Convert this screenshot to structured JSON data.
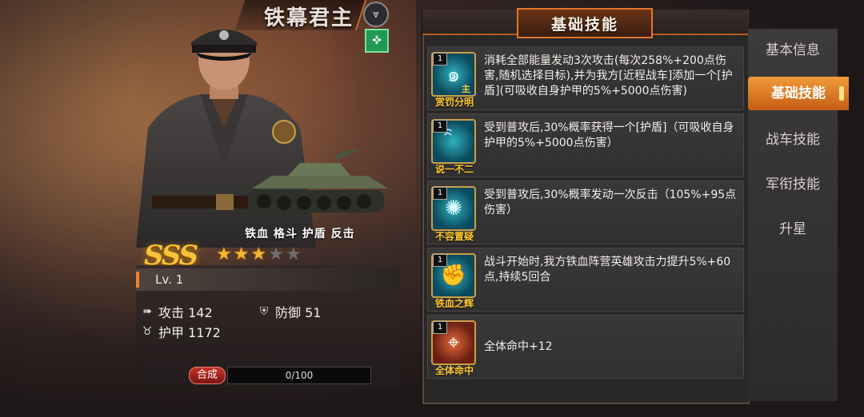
{
  "hero": {
    "name": "铁幕君主",
    "rank_icon": "chevron-rank-icon",
    "class_icon": "cross-class-icon",
    "tank_tags": "铁血 格斗 护盾 反击",
    "grade": "SSS",
    "stars": {
      "filled": 3,
      "total": 5
    },
    "level": "Lv. 1",
    "stats": {
      "attack": "攻击 142",
      "defense": "防御 51",
      "armor": "护甲 1172"
    },
    "compose_label": "合成",
    "progress": {
      "text": "0/100",
      "value": 0,
      "max": 100
    }
  },
  "panel": {
    "title": "基础技能",
    "skills": [
      {
        "level": "1",
        "tag": "主",
        "name": "赏罚分明",
        "icon": "ring-swirl-icon",
        "desc": "消耗全部能量发动3次攻击(每次258%+200点伤害,随机选择目标),并为我方[近程战车]添加一个[护盾](可吸收自身护甲的5%+5000点伤害)"
      },
      {
        "level": "1",
        "tag": "",
        "name": "说一不二",
        "icon": "swirl-icon",
        "desc": "受到普攻后,30%概率获得一个[护盾]（可吸收自身护甲的5%+5000点伤害）"
      },
      {
        "level": "1",
        "tag": "",
        "name": "不容置疑",
        "icon": "burst-icon",
        "desc": "受到普攻后,30%概率发动一次反击（105%+95点伤害）"
      },
      {
        "level": "1",
        "tag": "",
        "name": "铁血之辉",
        "icon": "fist-icon",
        "desc": "战斗开始时,我方铁血阵营英雄攻击力提升5%+60点,持续5回合"
      },
      {
        "level": "1",
        "tag": "",
        "name": "全体命中",
        "icon": "crosshair-icon",
        "desc": "全体命中+12"
      }
    ]
  },
  "tabs": [
    {
      "label": "基本信息",
      "active": false
    },
    {
      "label": "基础技能",
      "active": true
    },
    {
      "label": "战车技能",
      "active": false
    },
    {
      "label": "军衔技能",
      "active": false
    },
    {
      "label": "升星",
      "active": false
    }
  ],
  "colors": {
    "accent_orange": "#e0772c",
    "gold": "#ffc830",
    "star_on": "#f2b733",
    "star_off": "#6e6d70"
  }
}
